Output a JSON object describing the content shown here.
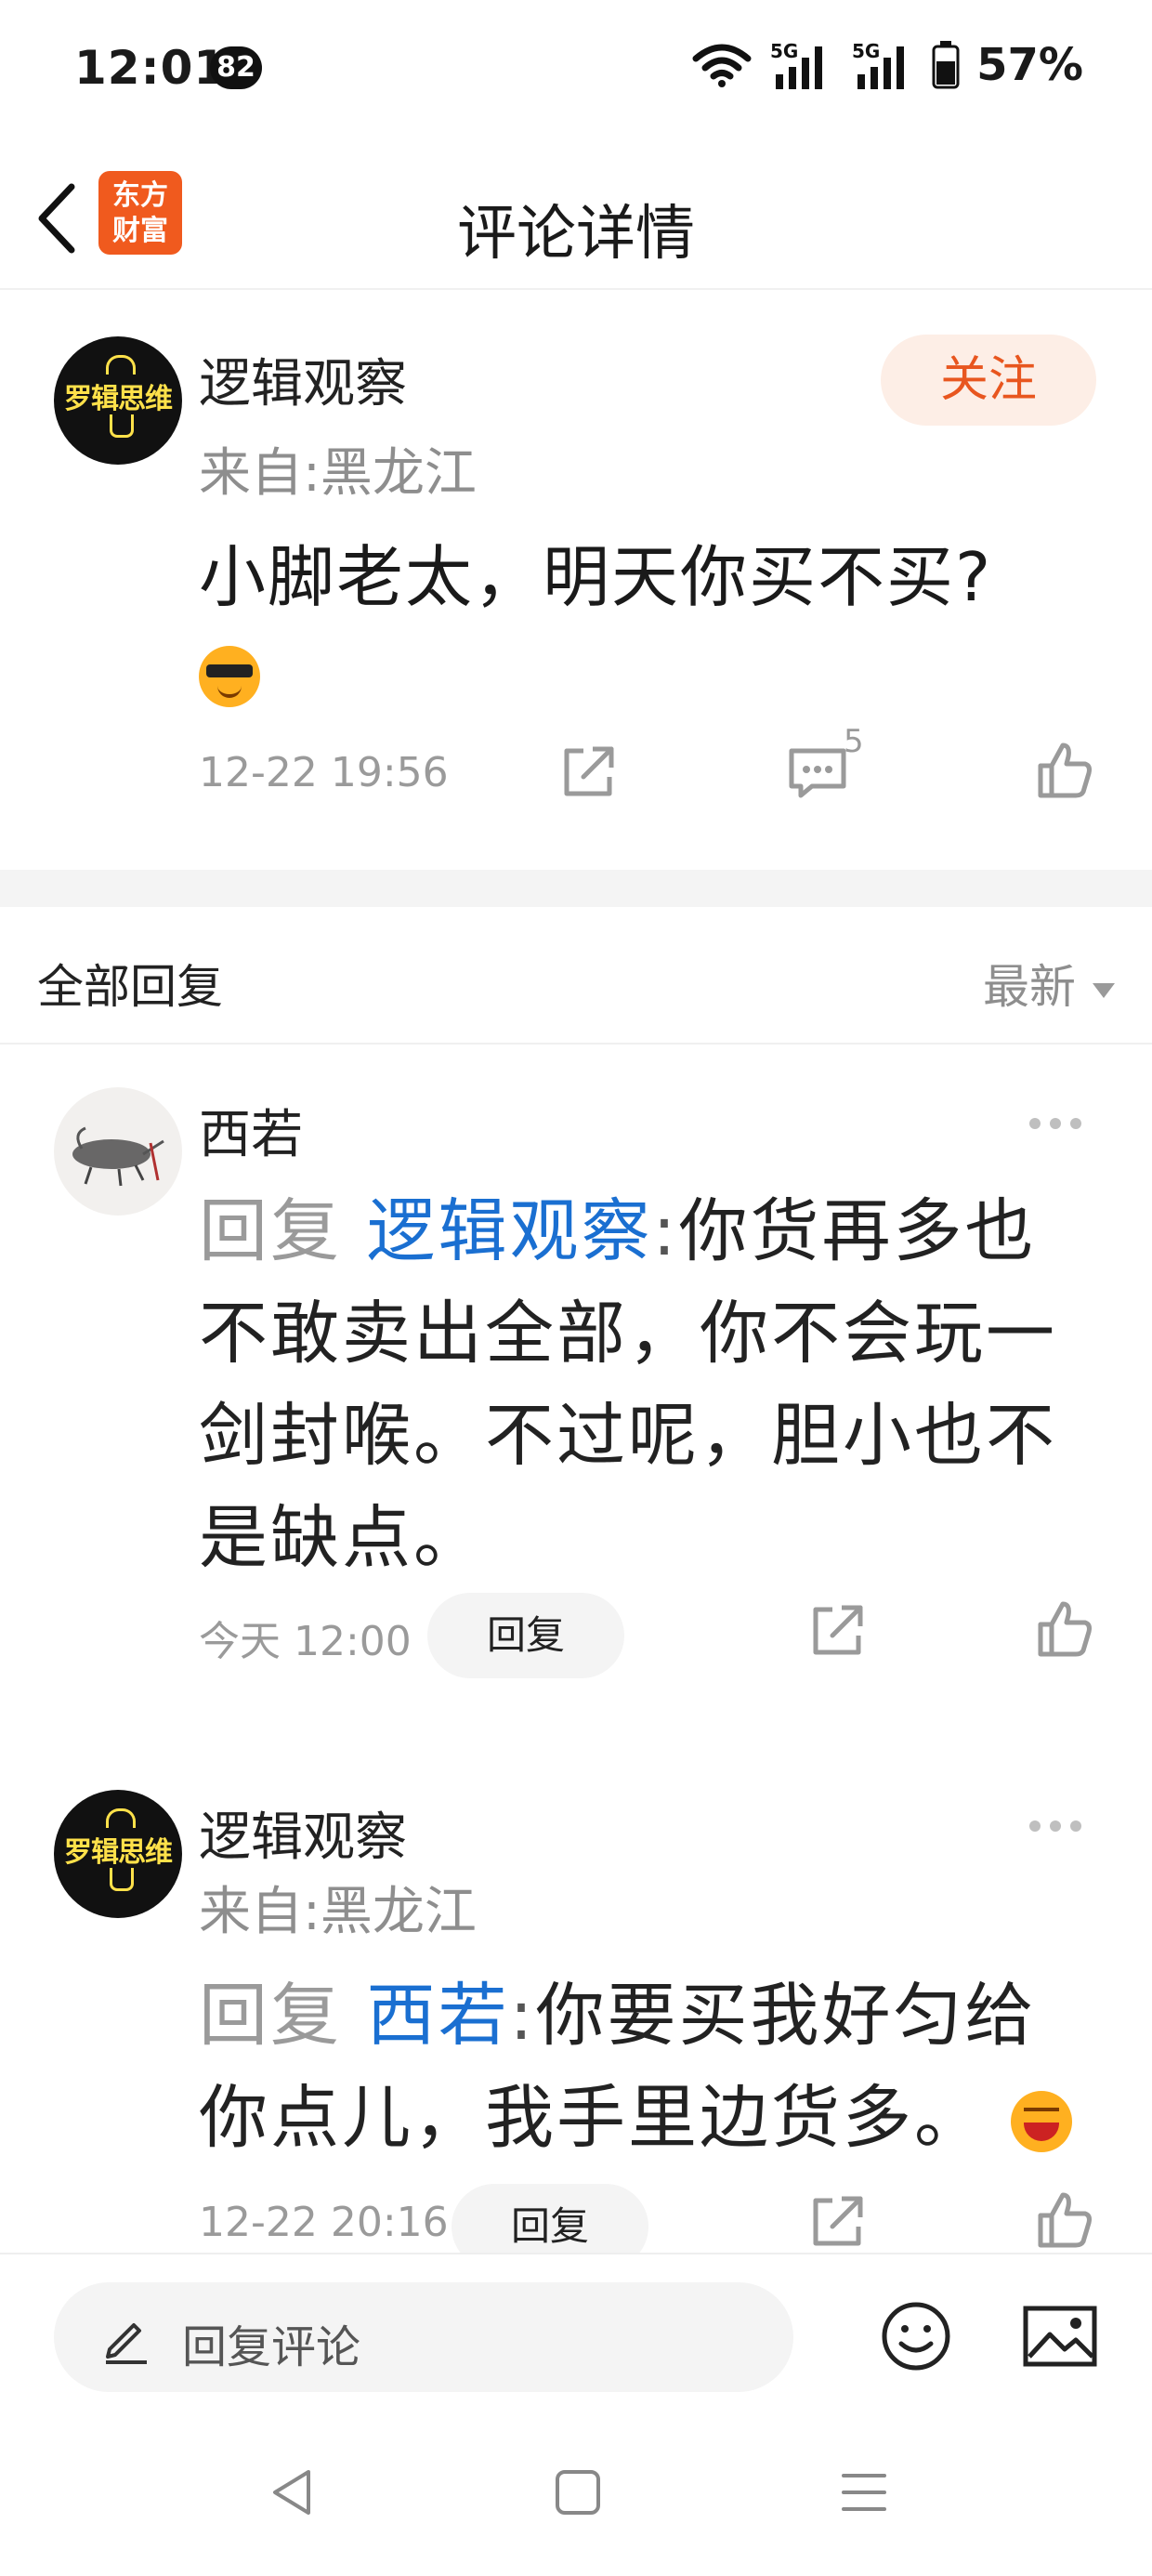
{
  "status_bar": {
    "time": "12:01",
    "notification_count": "82",
    "network": "5G",
    "battery": "57%"
  },
  "header": {
    "app_logo_line1": "东方",
    "app_logo_line2": "财富",
    "title": "评论详情"
  },
  "main_comment": {
    "username": "逻辑观察",
    "avatar_text": "罗辑思维",
    "location": "来自:黑龙江",
    "follow_label": "关注",
    "text": "小脚老太，明天你买不买?",
    "emoji": "cool-sunglasses-emoji",
    "time": "12-22 19:56",
    "comment_count": "5"
  },
  "replies_section": {
    "title": "全部回复",
    "sort_label": "最新"
  },
  "replies": [
    {
      "username": "西若",
      "prefix": "回复",
      "mention": "逻辑观察",
      "separator": ":",
      "text": "你货再多也不敢卖出全部，你不会玩一剑封喉。不过呢，胆小也不是缺点。",
      "time": "今天 12:00",
      "reply_label": "回复"
    },
    {
      "username": "逻辑观察",
      "avatar_text": "罗辑思维",
      "location": "来自:黑龙江",
      "prefix": "回复",
      "mention": "西若",
      "separator": ":",
      "text": "你要买我好匀给你点儿，我手里边货多。",
      "emoji": "laughing-emoji",
      "time": "12-22 20:16",
      "reply_label": "回复"
    }
  ],
  "bottom_bar": {
    "input_placeholder": "回复评论"
  },
  "colors": {
    "accent_orange": "#e8561f",
    "mention_blue": "#1a6fd1",
    "muted_gray": "#9a9a9a"
  }
}
